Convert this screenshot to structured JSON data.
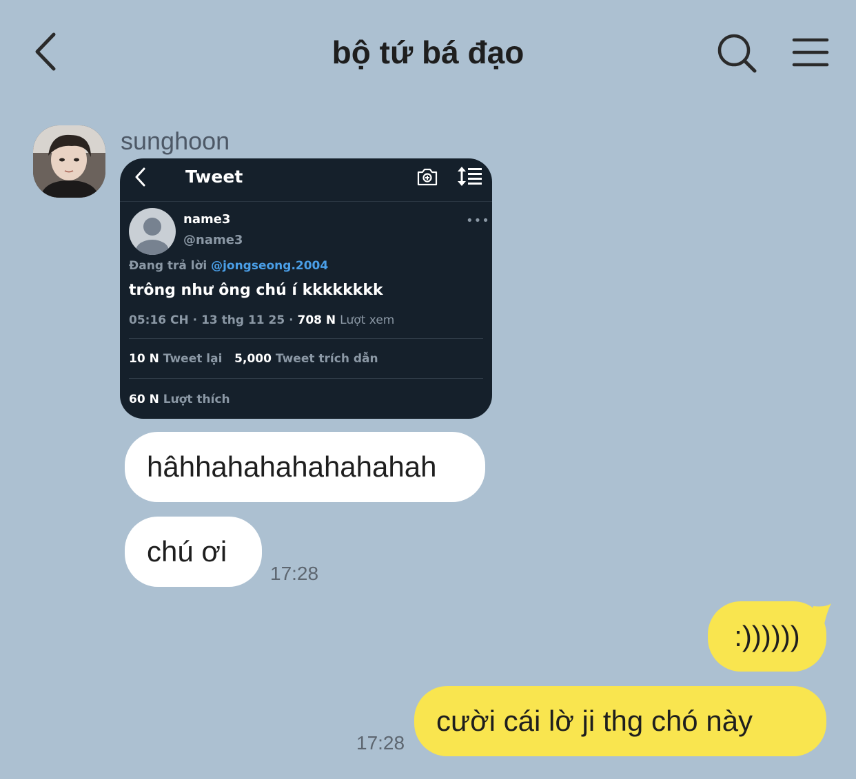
{
  "header": {
    "title": "bộ tứ bá đạo",
    "back_icon": "chevron-left-icon",
    "search_icon": "search-icon",
    "menu_icon": "hamburger-menu-icon"
  },
  "colors": {
    "background": "#acc0d1",
    "incoming_bubble": "#ffffff",
    "outgoing_bubble": "#f9e54f",
    "tweet_card_bg": "#15202b",
    "mention": "#4a9fe8"
  },
  "messages": {
    "sender": "sunghoon",
    "tweet": {
      "header_title": "Tweet",
      "name": "name3",
      "handle": "@name3",
      "reply_prefix": "Đang trả lời",
      "reply_mention": "@jongseong.2004",
      "text": "trông như ông chú í kkkkkkkk",
      "time": "05:16 CH",
      "date": "13 thg 11 25",
      "views_count": "708 N",
      "views_label": "Lượt xem",
      "retweets_count": "10 N",
      "retweets_label": "Tweet lại",
      "quotes_count": "5,000",
      "quotes_label": "Tweet trích dẫn",
      "likes_count": "60 N",
      "likes_label": "Lượt thích"
    },
    "incoming": [
      "hâhhahahahahahahah",
      "chú ơi"
    ],
    "incoming_time": "17:28",
    "outgoing": [
      ":))))))",
      "cười cái lờ ji thg chó này"
    ],
    "outgoing_time": "17:28"
  }
}
